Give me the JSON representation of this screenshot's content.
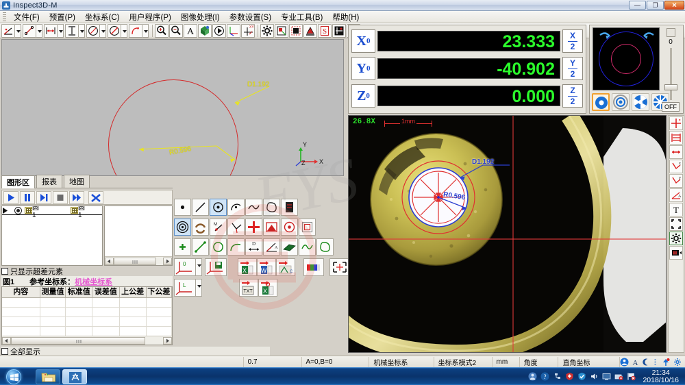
{
  "window": {
    "title": "Inspect3D-M",
    "icon": "app-icon",
    "controls": {
      "minimize": "—",
      "restore": "❐",
      "close": "✕"
    }
  },
  "menu": {
    "items": [
      {
        "label": "文件(F)"
      },
      {
        "label": "预置(P)"
      },
      {
        "label": "坐标系(C)"
      },
      {
        "label": "用户程序(P)"
      },
      {
        "label": "图像处理(I)"
      },
      {
        "label": "参数设置(S)"
      },
      {
        "label": "专业工具(B)"
      },
      {
        "label": "帮助(H)"
      }
    ]
  },
  "toolbar": {
    "buttons": [
      {
        "name": "measure-angle-tool",
        "icon": "angle-icon",
        "dropdown": true
      },
      {
        "name": "measure-line-tool",
        "icon": "line-icon",
        "dropdown": true
      },
      {
        "name": "measure-distance-tool",
        "icon": "distance-icon",
        "dropdown": true
      },
      {
        "name": "measure-height-tool",
        "icon": "height-icon",
        "dropdown": true
      },
      {
        "name": "measure-circle-tool",
        "icon": "circle-icon",
        "dropdown": true
      },
      {
        "name": "measure-noncircle-tool",
        "icon": "circle-slash-icon",
        "dropdown": true
      },
      {
        "name": "measure-arc-tool",
        "icon": "arc-icon",
        "dropdown": true
      }
    ],
    "buttons2": [
      {
        "name": "zoom-in-button",
        "icon": "magnifier-plus-icon"
      },
      {
        "name": "zoom-out-button",
        "icon": "magnifier-minus-icon"
      },
      {
        "name": "text-annotation-button",
        "icon": "letter-a-icon"
      },
      {
        "name": "view-3d-button",
        "icon": "cube-icon"
      },
      {
        "name": "play-view-button",
        "icon": "play-view-icon"
      },
      {
        "name": "coordinate-button",
        "icon": "axis-icon"
      },
      {
        "name": "xy-coordinate-button",
        "icon": "xy-axis-icon"
      }
    ],
    "buttons3": [
      {
        "name": "settings-button",
        "icon": "gear-icon"
      },
      {
        "name": "capture-button",
        "icon": "capture-icon"
      },
      {
        "name": "fill-button",
        "icon": "fill-square-icon"
      },
      {
        "name": "paint-button",
        "icon": "paint-icon"
      },
      {
        "name": "s-tool-button",
        "icon": "letter-s-icon"
      },
      {
        "name": "grid-tool-button",
        "icon": "grid-icon"
      },
      {
        "name": "align-bottom-button",
        "icon": "align-icon"
      }
    ]
  },
  "cad_view": {
    "labels": [
      {
        "text": "D1.192",
        "name": "cad-diameter-label",
        "color": "#e9e41f"
      },
      {
        "text": "R0.596",
        "name": "cad-radius-label",
        "color": "#e9e41f"
      }
    ],
    "axis": {
      "x": "X",
      "y": "Y",
      "z": "Z"
    },
    "circle_color": "#d42a2a"
  },
  "cad_tabs": {
    "items": [
      {
        "label": "图形区",
        "active": true
      },
      {
        "label": "报表",
        "active": false
      },
      {
        "label": "地图",
        "active": false
      }
    ]
  },
  "playbar": {
    "buttons": [
      {
        "name": "run-button",
        "icon": "play-icon"
      },
      {
        "name": "pause-button",
        "icon": "pause-icon"
      },
      {
        "name": "step-button",
        "icon": "step-icon"
      },
      {
        "name": "stop-button",
        "icon": "stop-icon"
      },
      {
        "name": "fast-forward-button",
        "icon": "fast-forward-icon"
      },
      {
        "name": "tools-button",
        "icon": "wrench-icon"
      }
    ]
  },
  "element_list": {
    "rows": [
      {
        "icon": "circle-element-icon",
        "name": "圆1",
        "alias": "圆1",
        "count": "1",
        "checked": true
      }
    ]
  },
  "filters": {
    "only_out_of_tolerance": "只显示超差元素",
    "show_all": "全部显示"
  },
  "report": {
    "element_name": "圆1",
    "ref_label": "参考坐标系：",
    "ref_value": "机械坐标系",
    "columns": [
      "内容",
      "测量值",
      "标准值",
      "误差值",
      "上公差",
      "下公差"
    ],
    "rows": []
  },
  "palette": {
    "row1": [
      {
        "name": "point-tool",
        "icon": "point-icon",
        "selected": false
      },
      {
        "name": "line-tool",
        "icon": "line-icon",
        "selected": false
      },
      {
        "name": "circle-tool",
        "icon": "circle-dot-icon",
        "selected": true
      },
      {
        "name": "arc-tool",
        "icon": "arc-icon",
        "selected": false
      },
      {
        "name": "curve-tool",
        "icon": "wave-icon",
        "selected": false
      },
      {
        "name": "freeform-tool",
        "icon": "blob-icon",
        "selected": false
      },
      {
        "name": "measure-tool",
        "icon": "measure-icon",
        "selected": false
      }
    ],
    "row2": [
      {
        "name": "concentric-tool",
        "icon": "concentric-circle-icon",
        "selected": true
      },
      {
        "name": "ring-tool",
        "icon": "ring-icon",
        "selected": false
      },
      {
        "name": "midpoint-tool",
        "icon": "midpoint-icon",
        "selected": false
      },
      {
        "name": "angle-bisect-tool",
        "icon": "bisect-icon",
        "selected": false
      },
      {
        "name": "cross-tool",
        "icon": "cross-icon",
        "selected": false
      },
      {
        "name": "area-tool",
        "icon": "area-icon",
        "selected": false
      },
      {
        "name": "center-circle-tool",
        "icon": "center-circle-icon",
        "selected": false
      },
      {
        "name": "frame-tool",
        "icon": "frame-icon",
        "selected": false
      }
    ],
    "row3": [
      {
        "name": "construct-point-tool",
        "icon": "green-point-icon",
        "selected": false
      },
      {
        "name": "construct-line-tool",
        "icon": "green-line-icon",
        "selected": false
      },
      {
        "name": "construct-circle-tool",
        "icon": "green-circle-icon",
        "selected": false
      },
      {
        "name": "construct-arc-tool",
        "icon": "green-arc-icon",
        "selected": false
      },
      {
        "name": "distance-dim-tool",
        "icon": "distance-d-icon",
        "selected": false
      },
      {
        "name": "angle-dim-tool",
        "icon": "angle-a-icon",
        "selected": false
      },
      {
        "name": "plane-tool",
        "icon": "plane-icon",
        "selected": false
      },
      {
        "name": "spline-tool",
        "icon": "green-wave-icon",
        "selected": false
      },
      {
        "name": "green-blob-tool",
        "icon": "green-blob-icon",
        "selected": false
      }
    ],
    "row4": [
      {
        "name": "origin-set-button",
        "icon": "axis-zero-icon",
        "dropdown": true
      },
      {
        "name": "save-coord-button",
        "icon": "axis-save-icon"
      },
      {
        "name": "export-excel-button",
        "icon": "excel-icon"
      },
      {
        "name": "export-word-button",
        "icon": "word-icon"
      },
      {
        "name": "export-cad-button",
        "icon": "cad-icon"
      },
      {
        "name": "color-bar-button",
        "icon": "color-bar-icon"
      },
      {
        "name": "fit-view-button",
        "icon": "fit-frame-icon",
        "dropdown": true
      }
    ],
    "row5": [
      {
        "name": "load-coord-button",
        "icon": "axis-load-icon",
        "dropdown": true
      },
      {
        "name": "export-txt-button",
        "icon": "txt-icon"
      },
      {
        "name": "export-excel2-button",
        "icon": "excel2-icon"
      }
    ]
  },
  "dro": {
    "rows": [
      {
        "axis": "X",
        "sub": "0",
        "value": "23.333",
        "half_label": "X",
        "half_denom": "2"
      },
      {
        "axis": "Y",
        "sub": "0",
        "value": "-40.902",
        "half_label": "Y",
        "half_denom": "2"
      },
      {
        "axis": "Z",
        "sub": "0",
        "value": "0.000",
        "half_label": "Z",
        "half_denom": "2"
      }
    ],
    "value_color": "#2bff2b",
    "label_color": "#1d4fd0"
  },
  "light_panel": {
    "slider_value": "0",
    "off_label": "OFF",
    "modes": [
      {
        "name": "ring-mode-full",
        "icon": "solid-ring-icon",
        "selected": true
      },
      {
        "name": "ring-mode-outline",
        "icon": "outline-ring-icon",
        "selected": false
      },
      {
        "name": "ring-mode-quad",
        "icon": "quad-ring-icon",
        "selected": false
      },
      {
        "name": "ring-mode-octa",
        "icon": "octa-ring-icon",
        "selected": false
      }
    ]
  },
  "camera": {
    "zoom_label": "26.8X",
    "scale_label": "1mm",
    "labels": [
      {
        "text": "D1.192",
        "name": "camera-diameter-label",
        "color": "#2b3fd0"
      },
      {
        "text": "R0.596",
        "name": "camera-radius-label",
        "color": "#2b3fd0"
      }
    ]
  },
  "right_toolbar": {
    "buttons": [
      {
        "name": "crosshair-tool",
        "icon": "crosshair-icon"
      },
      {
        "name": "dimension-tool",
        "icon": "dimension-icon"
      },
      {
        "name": "length-tool",
        "icon": "length-icon"
      },
      {
        "name": "x-angle-tool",
        "icon": "x-angle-icon"
      },
      {
        "name": "y-angle-tool",
        "icon": "y-angle-icon"
      },
      {
        "name": "angle-tool",
        "icon": "angle-a-icon"
      },
      {
        "name": "text-tool",
        "icon": "text-t-icon"
      },
      {
        "name": "fullscreen-tool",
        "icon": "fullscreen-icon"
      },
      {
        "name": "settings-tool",
        "icon": "gear-icon",
        "selected": true
      },
      {
        "name": "bar-tool",
        "icon": "red-bar-icon"
      }
    ]
  },
  "statusbar": {
    "cells": [
      "",
      "0.7",
      "A=0,B=0",
      "机械坐标系",
      "坐标系模式2",
      "mm",
      "角度",
      "直角坐标"
    ],
    "icons": [
      "user-icon",
      "letter-a-icon",
      "moon-icon",
      "dots-icon",
      "pin-icon",
      "gear-icon"
    ]
  },
  "taskbar": {
    "start": "start-orb",
    "items": [
      {
        "name": "taskbar-explorer",
        "icon": "folder-icon"
      },
      {
        "name": "taskbar-inspect3d",
        "icon": "app-icon"
      }
    ],
    "tray_icons": [
      "user-icon",
      "help-icon",
      "network-icon",
      "shield-red-icon",
      "shield-blue-icon",
      "volume-icon",
      "monitor-icon",
      "battery-icon",
      "flag-icon"
    ],
    "clock_time": "21:34",
    "clock_date": "2018/10/16"
  }
}
